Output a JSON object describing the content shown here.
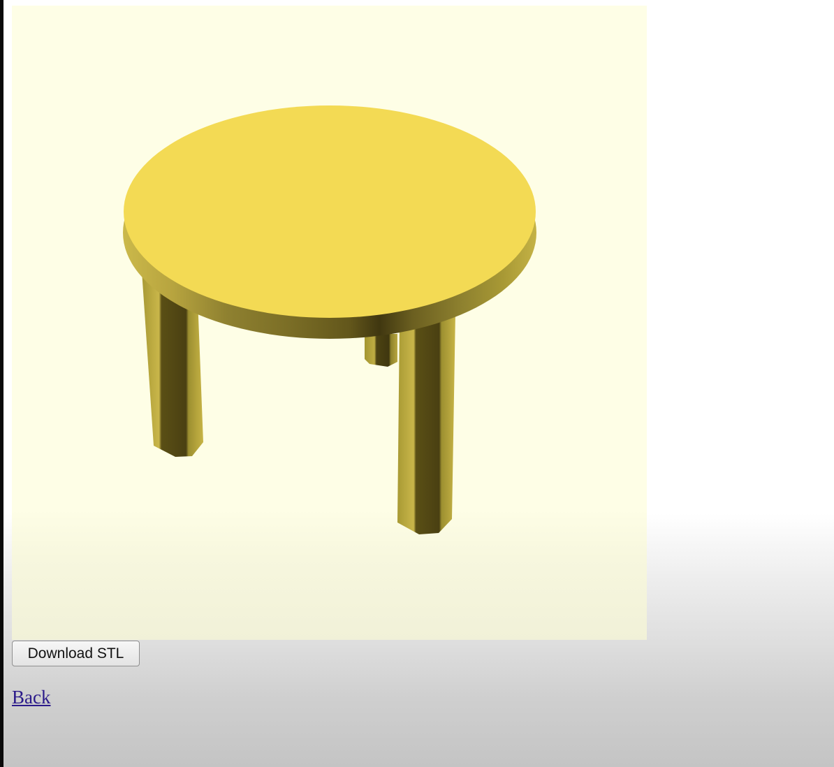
{
  "viewer": {
    "model": "round-table-3-legs",
    "background_color": "#fefee6",
    "model_color": "#f3da54"
  },
  "actions": {
    "download_label": "Download STL",
    "back_label": "Back"
  }
}
